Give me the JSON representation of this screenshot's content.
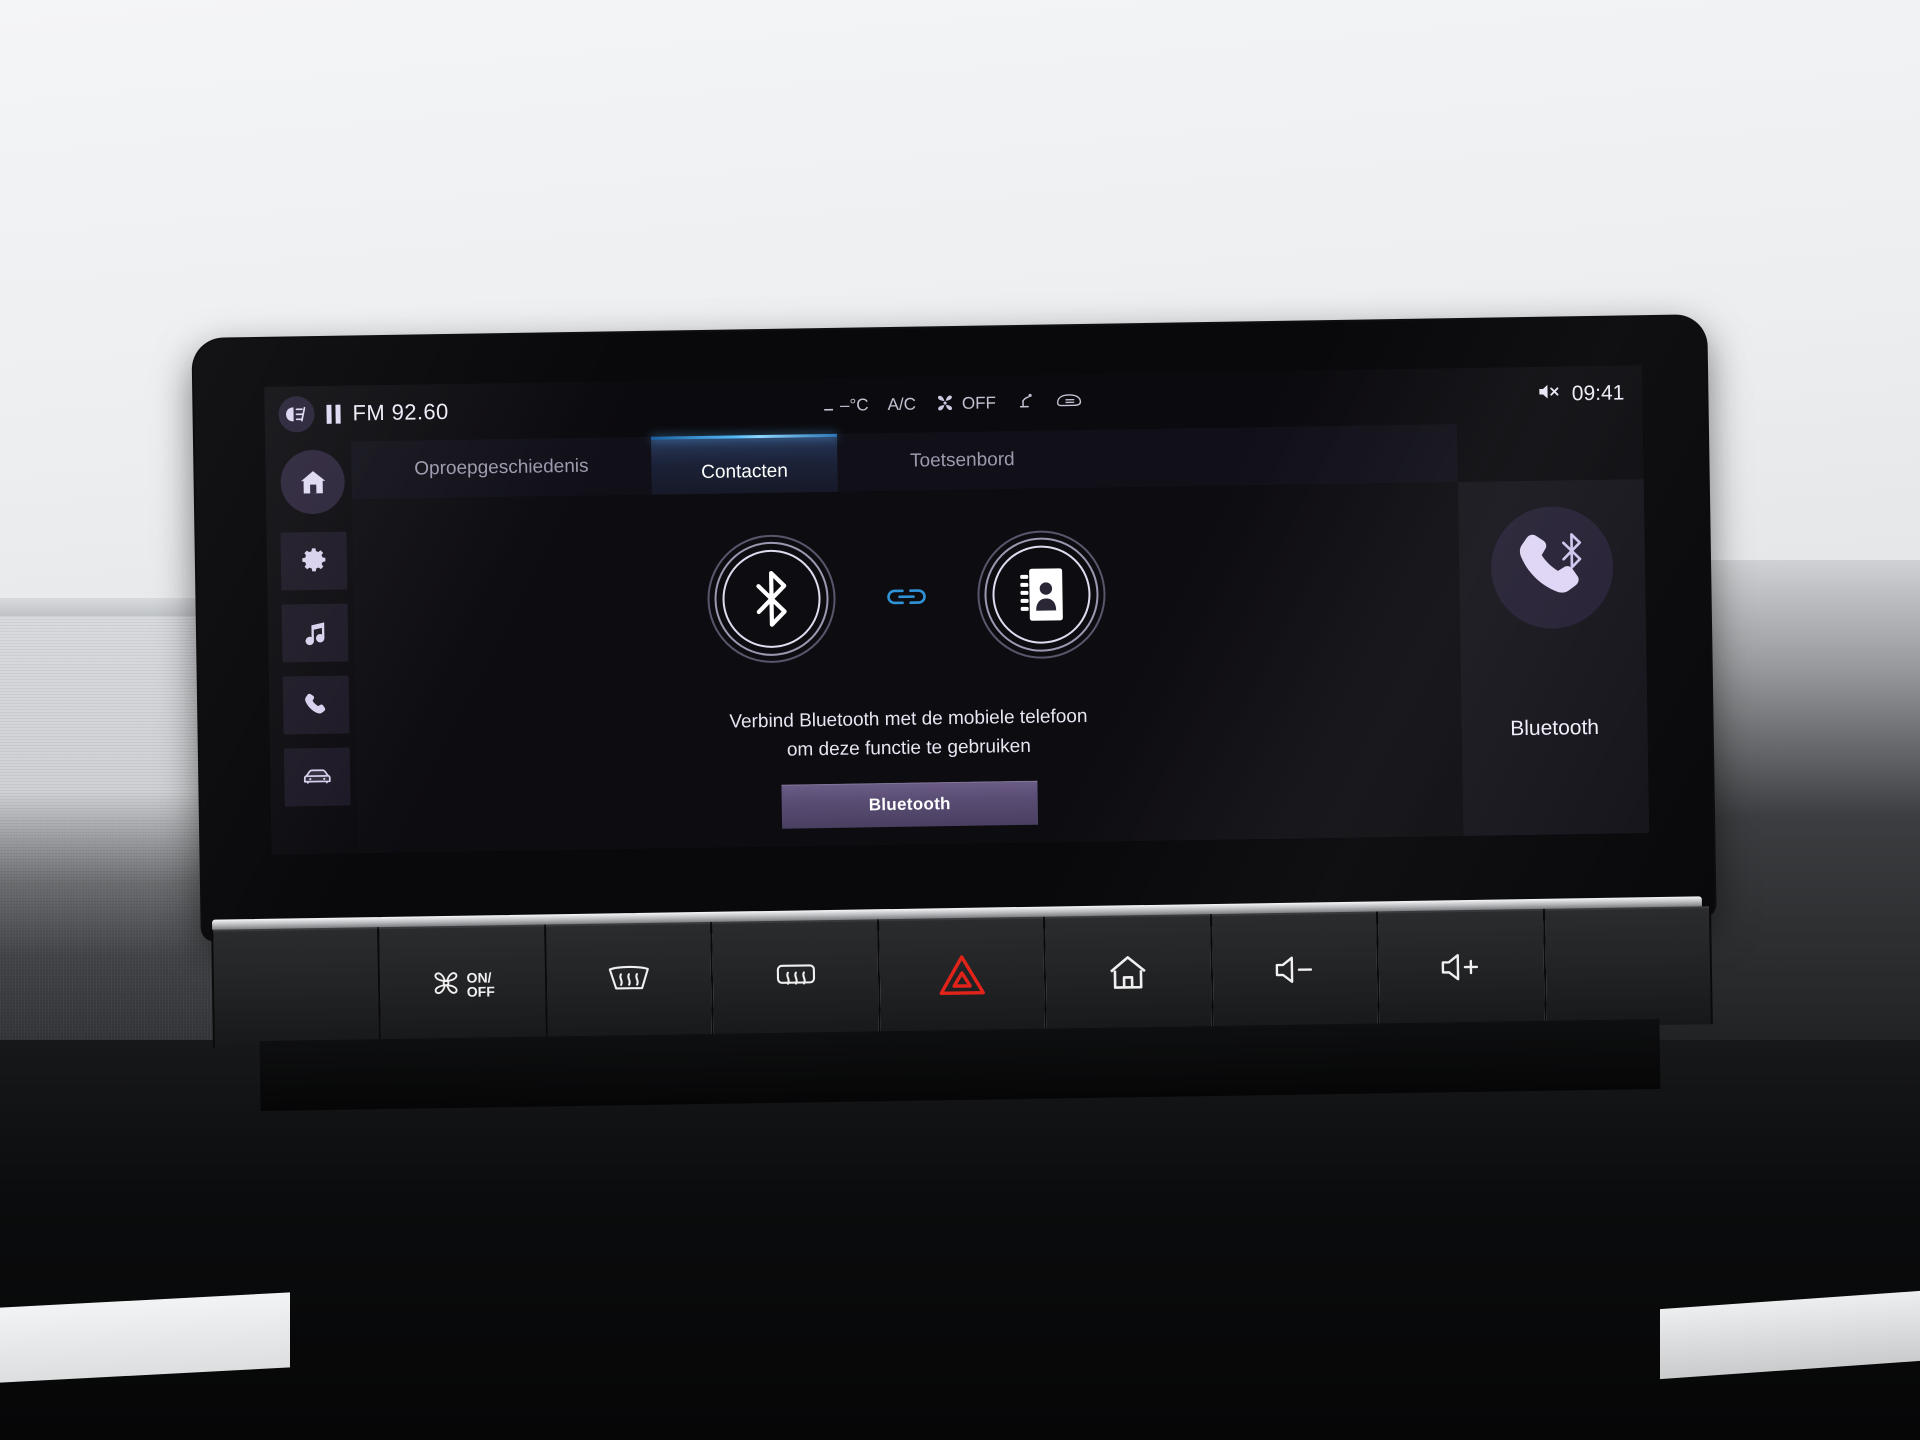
{
  "status_bar": {
    "headlight_icon": "fog-light-icon",
    "playback_icon": "pause-icon",
    "radio_source": "FM 92.60",
    "climate": [
      {
        "icon": "temperature-icon",
        "label": "–°C"
      },
      {
        "icon": "ac-icon",
        "label": "A/C"
      },
      {
        "icon": "fan-icon",
        "label": "OFF"
      },
      {
        "icon": "seat-heater-icon",
        "label": ""
      },
      {
        "icon": "rear-defrost-icon",
        "label": ""
      }
    ],
    "volume_icon": "volume-mute-icon",
    "clock": "09:41"
  },
  "sidebar": {
    "items": [
      {
        "name": "home",
        "icon": "home-icon",
        "active": true
      },
      {
        "name": "settings",
        "icon": "gear-icon",
        "active": false
      },
      {
        "name": "media",
        "icon": "music-note-icon",
        "active": false
      },
      {
        "name": "phone",
        "icon": "phone-icon",
        "active": false
      },
      {
        "name": "vehicle",
        "icon": "car-icon",
        "active": false
      }
    ]
  },
  "tabs": [
    {
      "label": "Oproepgeschiedenis",
      "active": false
    },
    {
      "label": "Contacten",
      "active": true
    },
    {
      "label": "Toetsenbord",
      "active": false
    }
  ],
  "main": {
    "left_node_icon": "bluetooth-icon",
    "link_icon": "link-icon",
    "right_node_icon": "contacts-book-icon",
    "hint_line_1": "Verbind Bluetooth met de mobiele telefoon",
    "hint_line_2": "om deze functie te gebruiken",
    "bluetooth_button": "Bluetooth"
  },
  "right_panel": {
    "icon": "phone-bluetooth-icon",
    "label": "Bluetooth"
  },
  "hard_keys": [
    {
      "name": "fan-on-off",
      "icon": "fan-icon",
      "label_top": "ON/",
      "label_bottom": "OFF"
    },
    {
      "name": "front-defrost",
      "icon": "front-defrost-icon",
      "label_top": "",
      "label_bottom": ""
    },
    {
      "name": "rear-defrost",
      "icon": "rear-defrost-icon",
      "label_top": "",
      "label_bottom": ""
    },
    {
      "name": "hazard-lights",
      "icon": "hazard-triangle-icon",
      "label_top": "",
      "label_bottom": ""
    },
    {
      "name": "home",
      "icon": "home-outline-icon",
      "label_top": "",
      "label_bottom": ""
    },
    {
      "name": "volume-down",
      "icon": "volume-down-icon",
      "label_top": "",
      "label_bottom": ""
    },
    {
      "name": "volume-up",
      "icon": "volume-up-icon",
      "label_top": "",
      "label_bottom": ""
    }
  ],
  "colors": {
    "accent_lavender": "#d9d2f0",
    "tab_active_blue": "#53b9f5",
    "hazard_red": "#e2231a",
    "screen_bg": "#0b0a0e"
  }
}
